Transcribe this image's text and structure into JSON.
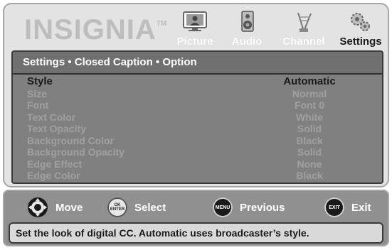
{
  "brand": {
    "name": "INSIGNIA",
    "tm": "TM"
  },
  "tabs": [
    {
      "label": "Picture",
      "icon": "picture-icon"
    },
    {
      "label": "Audio",
      "icon": "speaker-icon"
    },
    {
      "label": "Channel",
      "icon": "antenna-icon"
    },
    {
      "label": "Settings",
      "icon": "gears-icon",
      "active": true
    }
  ],
  "panel": {
    "breadcrumb": "Settings • Closed Caption • Option",
    "rows": [
      {
        "label": "Style",
        "value": "Automatic",
        "selected": true
      },
      {
        "label": "Size",
        "value": "Normal"
      },
      {
        "label": "Font",
        "value": "Font 0"
      },
      {
        "label": "Text Color",
        "value": "White"
      },
      {
        "label": "Text Opacity",
        "value": "Solid"
      },
      {
        "label": "Background Color",
        "value": "Black"
      },
      {
        "label": "Background Opacity",
        "value": "Solid"
      },
      {
        "label": "Edge Effect",
        "value": "None"
      },
      {
        "label": "Edge Color",
        "value": "Black"
      }
    ]
  },
  "nav": {
    "move": {
      "label": "Move",
      "icon": "dpad-icon"
    },
    "select": {
      "label": "Select",
      "icon": "ok-enter-icon",
      "icon_text_top": "OK",
      "icon_text_bottom": "ENTER"
    },
    "previous": {
      "label": "Previous",
      "icon": "menu-button-icon",
      "icon_text": "MENU"
    },
    "exit": {
      "label": "Exit",
      "icon": "exit-button-icon",
      "icon_text": "EXIT"
    }
  },
  "help_text": "Set the look of digital CC. Automatic uses broadcaster’s style.",
  "colors": {
    "panel_bg": "#808080",
    "highlight_text": "#1a1a1a",
    "inactive_text": "#a0a0a0"
  }
}
